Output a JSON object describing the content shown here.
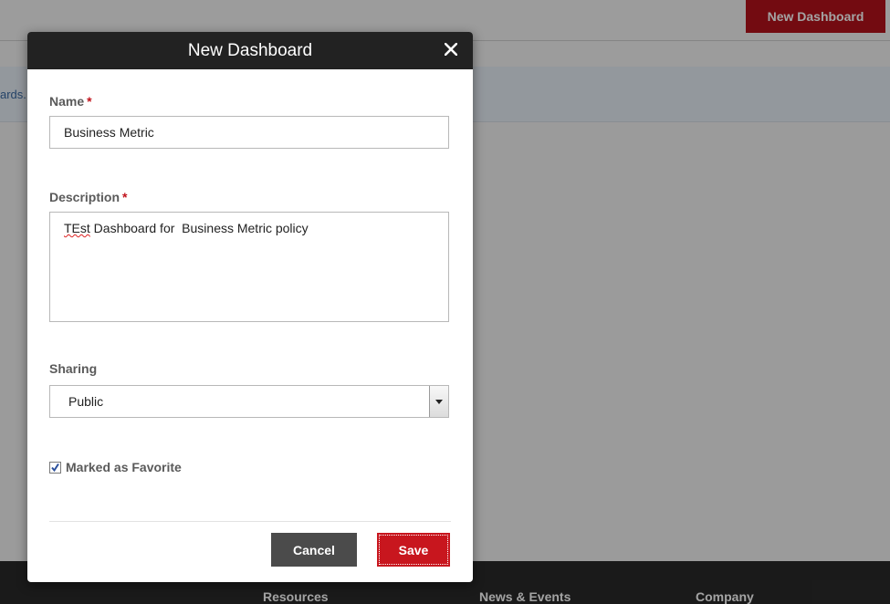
{
  "background": {
    "header_button_label": "New Dashboard",
    "info_text": "ards.",
    "footer_links": [
      "Resources",
      "News & Events",
      "Company"
    ]
  },
  "modal": {
    "title": "New Dashboard",
    "close_icon": "close-icon",
    "name": {
      "label": "Name",
      "required_marker": "*",
      "value": "Business Metric"
    },
    "description": {
      "label": "Description",
      "required_marker": "*",
      "value_misspelled": "TEst",
      "value_rest": " Dashboard for  Business Metric policy"
    },
    "sharing": {
      "label": "Sharing",
      "selected": "Public"
    },
    "favorite": {
      "label": "Marked as Favorite",
      "checked": true
    },
    "buttons": {
      "cancel": "Cancel",
      "save": "Save"
    }
  },
  "colors": {
    "accent_red": "#c8161e",
    "header_dark": "#222222",
    "cancel_gray": "#4b4b4b"
  }
}
